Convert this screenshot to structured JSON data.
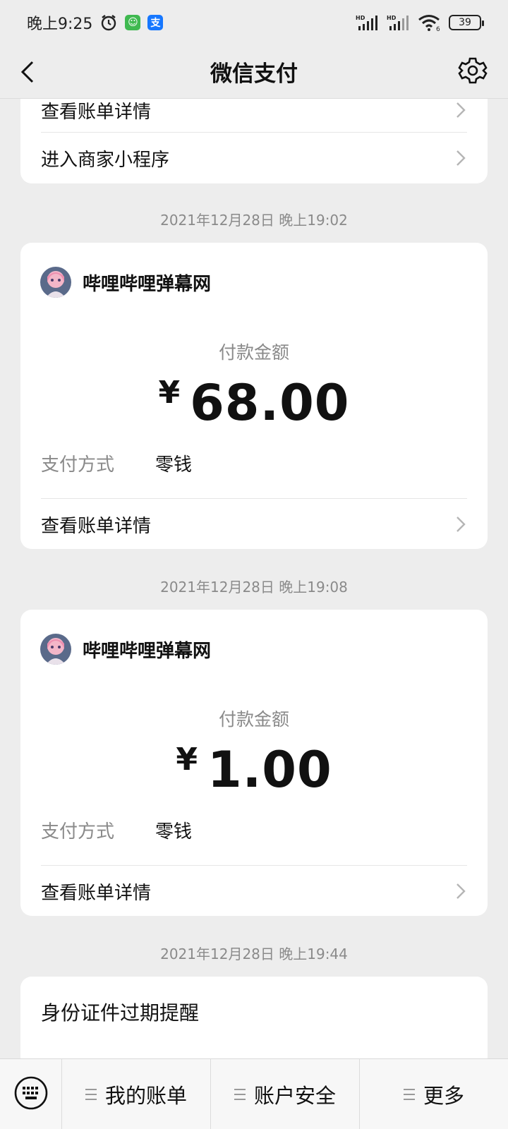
{
  "status_bar": {
    "time": "晚上9:25",
    "battery": "39",
    "signal_label_1": "HD",
    "signal_label_2": "HD",
    "wifi_sub": "6"
  },
  "nav": {
    "title": "微信支付"
  },
  "first_card": {
    "rows": [
      {
        "label": "查看账单详情"
      },
      {
        "label": "进入商家小程序"
      }
    ]
  },
  "payments": [
    {
      "timestamp": "2021年12月28日 晚上19:02",
      "merchant": "哔哩哔哩弹幕网",
      "amount_label": "付款金额",
      "currency": "¥",
      "amount": "68.00",
      "method_key": "支付方式",
      "method_value": "零钱",
      "detail_link": "查看账单详情"
    },
    {
      "timestamp": "2021年12月28日 晚上19:08",
      "merchant": "哔哩哔哩弹幕网",
      "amount_label": "付款金额",
      "currency": "¥",
      "amount": "1.00",
      "method_key": "支付方式",
      "method_value": "零钱",
      "detail_link": "查看账单详情"
    }
  ],
  "notice": {
    "timestamp": "2021年12月28日 晚上19:44",
    "title": "身份证件过期提醒"
  },
  "bottom_menu": [
    {
      "label": "我的账单"
    },
    {
      "label": "账户安全"
    },
    {
      "label": "更多"
    }
  ],
  "colors": {
    "background": "#ededed",
    "card": "#ffffff",
    "secondary_text": "#8a8a8a"
  }
}
